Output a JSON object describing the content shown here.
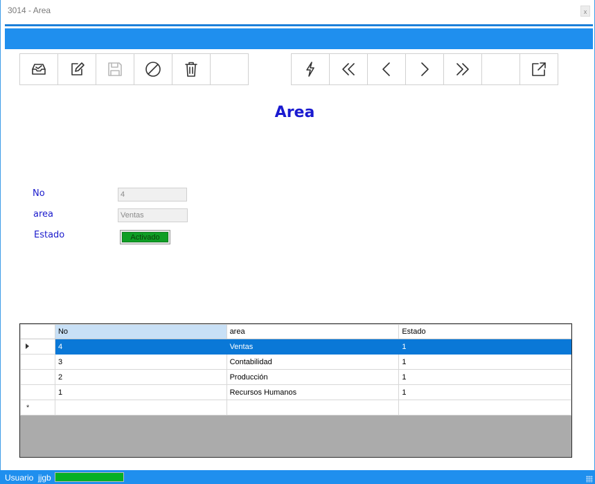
{
  "window": {
    "title": "3014 - Area",
    "close_label": "x"
  },
  "toolbar": {
    "left_buttons": [
      {
        "name": "inbox-icon"
      },
      {
        "name": "edit-icon"
      },
      {
        "name": "save-icon"
      },
      {
        "name": "cancel-icon"
      },
      {
        "name": "delete-icon"
      },
      {
        "name": "empty"
      }
    ],
    "right_buttons": [
      {
        "name": "lightning-icon"
      },
      {
        "name": "first-icon"
      },
      {
        "name": "previous-icon"
      },
      {
        "name": "next-icon"
      },
      {
        "name": "last-icon"
      },
      {
        "name": "empty"
      },
      {
        "name": "export-icon"
      }
    ]
  },
  "form": {
    "title": "Area",
    "no_label": "No",
    "no_value": "4",
    "area_label": "area",
    "area_value": "Ventas",
    "estado_label": "Estado",
    "estado_value": "Activado",
    "estado_color": "#0f9e25"
  },
  "grid": {
    "columns": [
      "No",
      "area",
      "Estado"
    ],
    "rows": [
      {
        "no": "4",
        "area": "Ventas",
        "estado": "1",
        "selected": true
      },
      {
        "no": "3",
        "area": "Contabilidad",
        "estado": "1",
        "selected": false
      },
      {
        "no": "2",
        "area": "Producción",
        "estado": "1",
        "selected": false
      },
      {
        "no": "1",
        "area": "Recursos Humanos",
        "estado": "1",
        "selected": false
      }
    ],
    "new_row_marker": "*",
    "selection_color": "#0a78d7"
  },
  "status": {
    "user_label": "Usuario",
    "user_name": "jjgb",
    "progress": 1.0,
    "accent_color": "#1f8fee"
  }
}
